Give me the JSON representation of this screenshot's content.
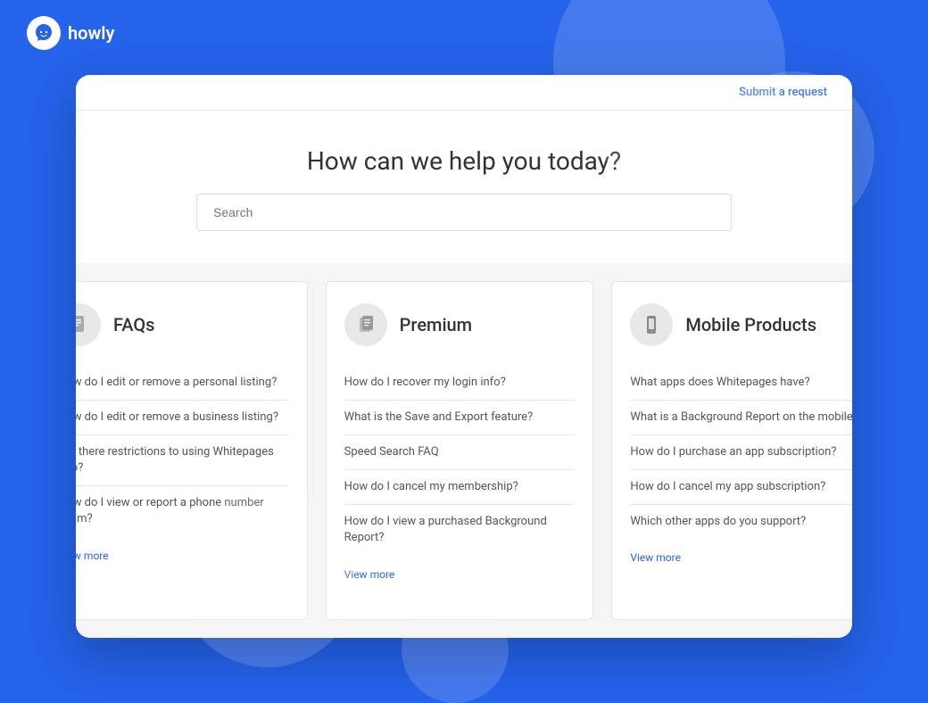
{
  "header": {
    "logo_text": "howly",
    "submit_request_label": "Submit a request"
  },
  "hero": {
    "title": "How can we help you today?",
    "search_placeholder": "Search"
  },
  "categories": [
    {
      "id": "faqs",
      "icon": "📄",
      "title": "FAQs",
      "items": [
        "How do I edit or remove a personal listing?",
        "How do I edit or remove a business listing?",
        "Are there restrictions to using Whitepages info?",
        "How do I view or report a phone number spam?"
      ],
      "view_more": "View more"
    },
    {
      "id": "premium",
      "icon": "📰",
      "title": "Premium",
      "items": [
        "How do I recover my login info?",
        "What is the Save and Export feature?",
        "Speed Search FAQ",
        "How do I cancel my membership?",
        "How do I view a purchased Background Report?"
      ],
      "view_more": "View more"
    },
    {
      "id": "mobile",
      "icon": "📱",
      "title": "Mobile Products",
      "items": [
        "What apps does Whitepages have?",
        "What is a Background Report on the mobile app?",
        "How do I purchase an app subscription?",
        "How do I cancel my app subscription?",
        "Which other apps do you support?"
      ],
      "view_more": "View more"
    }
  ]
}
